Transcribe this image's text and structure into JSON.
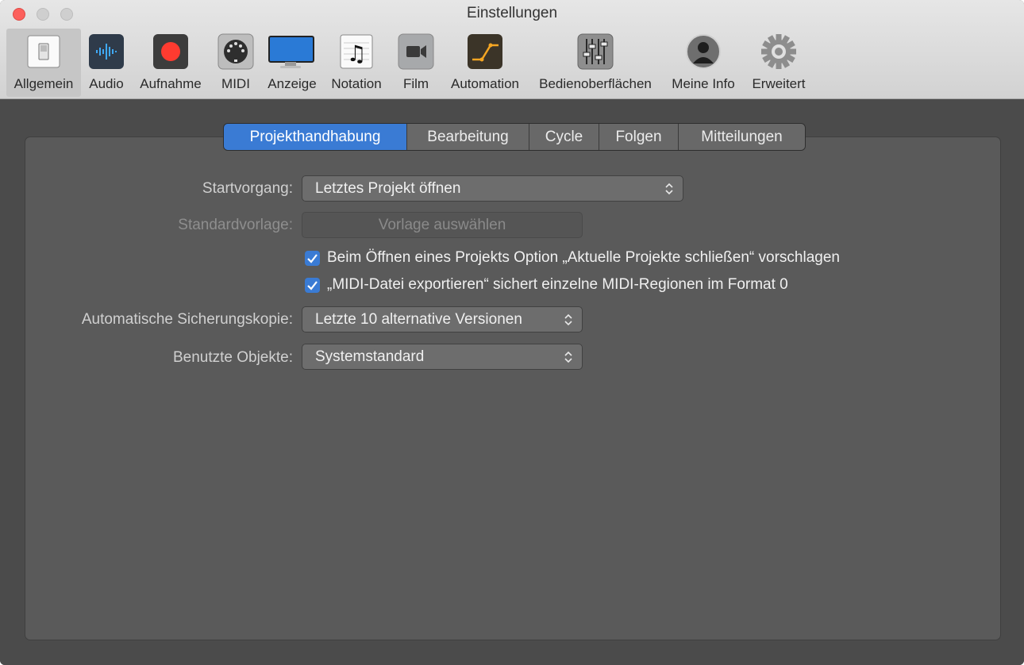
{
  "window": {
    "title": "Einstellungen"
  },
  "toolbar": {
    "items": [
      {
        "label": "Allgemein",
        "icon": "switch-icon",
        "selected": true
      },
      {
        "label": "Audio",
        "icon": "waveform-icon"
      },
      {
        "label": "Aufnahme",
        "icon": "record-icon"
      },
      {
        "label": "MIDI",
        "icon": "midi-port-icon"
      },
      {
        "label": "Anzeige",
        "icon": "display-icon"
      },
      {
        "label": "Notation",
        "icon": "music-note-icon"
      },
      {
        "label": "Film",
        "icon": "video-camera-icon"
      },
      {
        "label": "Automation",
        "icon": "automation-curve-icon"
      },
      {
        "label": "Bedienoberflächen",
        "icon": "faders-icon"
      },
      {
        "label": "Meine Info",
        "icon": "user-silhouette-icon"
      },
      {
        "label": "Erweitert",
        "icon": "gear-icon"
      }
    ]
  },
  "tabs": [
    {
      "label": "Projekthandhabung",
      "active": true
    },
    {
      "label": "Bearbeitung"
    },
    {
      "label": "Cycle"
    },
    {
      "label": "Folgen"
    },
    {
      "label": "Mitteilungen"
    }
  ],
  "settings": {
    "startvorgang": {
      "label": "Startvorgang:",
      "value": "Letztes Projekt öffnen"
    },
    "standardvorlage": {
      "label": "Standardvorlage:",
      "button": "Vorlage auswählen",
      "disabled": true
    },
    "checkbox1": {
      "label": "Beim Öffnen eines Projekts Option „Aktuelle Projekte schließen“ vorschlagen",
      "checked": true
    },
    "checkbox2": {
      "label": "„MIDI-Datei exportieren“ sichert einzelne MIDI-Regionen im Format 0",
      "checked": true
    },
    "sicherung": {
      "label": "Automatische Sicherungskopie:",
      "value": "Letzte 10 alternative Versionen"
    },
    "objekte": {
      "label": "Benutzte Objekte:",
      "value": "Systemstandard"
    }
  },
  "colors": {
    "accent": "#3a7bd4",
    "record": "#ff3b30",
    "automation": "#f5a623"
  }
}
